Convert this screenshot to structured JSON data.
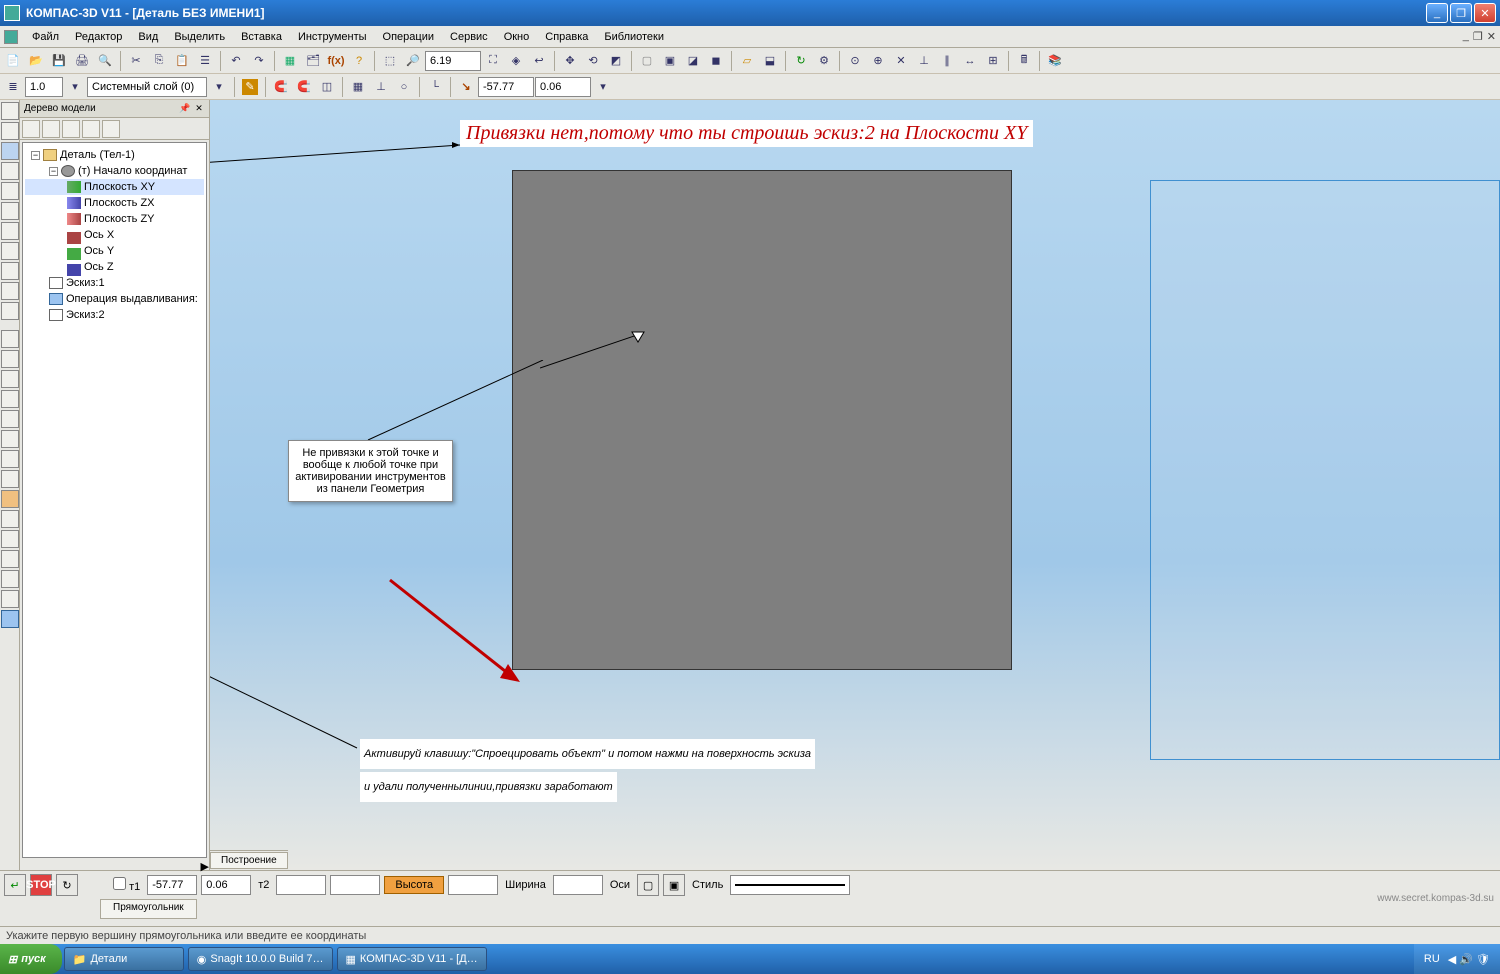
{
  "title": "КОМПАС-3D V11 - [Деталь БЕЗ ИМЕНИ1]",
  "menu": [
    "Файл",
    "Редактор",
    "Вид",
    "Выделить",
    "Вставка",
    "Инструменты",
    "Операции",
    "Сервис",
    "Окно",
    "Справка",
    "Библиотеки"
  ],
  "layer": {
    "value": "1.0",
    "name": "Системный слой (0)"
  },
  "coords": {
    "x": "6.19",
    "y": "-57.77",
    "z": "0.06"
  },
  "tree": {
    "title": "Дерево модели",
    "root": "Деталь (Тел-1)",
    "origin": "(т) Начало координат",
    "planes": [
      "Плоскость XY",
      "Плоскость ZX",
      "Плоскость ZY"
    ],
    "axes": [
      "Ось X",
      "Ось Y",
      "Ось Z"
    ],
    "items": [
      "Эскиз:1",
      "Операция выдавливания:",
      "Эскиз:2"
    ]
  },
  "callout": "Не привязки к этой точке и вообще к любой точке при активировании инструментов из панели Геометрия",
  "annot1": "Привязки нет,потому что ты строишь эскиз:2 на Плоскости XY",
  "annot2a": "Активируй клавишу:\"Спроецировать объект\" и потом нажми на поверхность эскиза",
  "annot2b": "и удали полученнылинии,привязки заработают",
  "build_tab": "Построение",
  "prop": {
    "t1": "т1",
    "v1": "-57.77",
    "v2": "0.06",
    "t2": "т2",
    "height": "Высота",
    "width": "Ширина",
    "osy": "Оси",
    "style": "Стиль",
    "shape_tab": "Прямоугольник"
  },
  "status": "Укажите первую вершину прямоугольника или введите ее координаты",
  "taskbar": {
    "start": "пуск",
    "tasks": [
      "Детали",
      "SnagIt 10.0.0 Build 7…",
      "КОМПАС-3D V11 - [Д…"
    ],
    "lang": "RU"
  },
  "watermark": "www.secret.kompas-3d.su"
}
